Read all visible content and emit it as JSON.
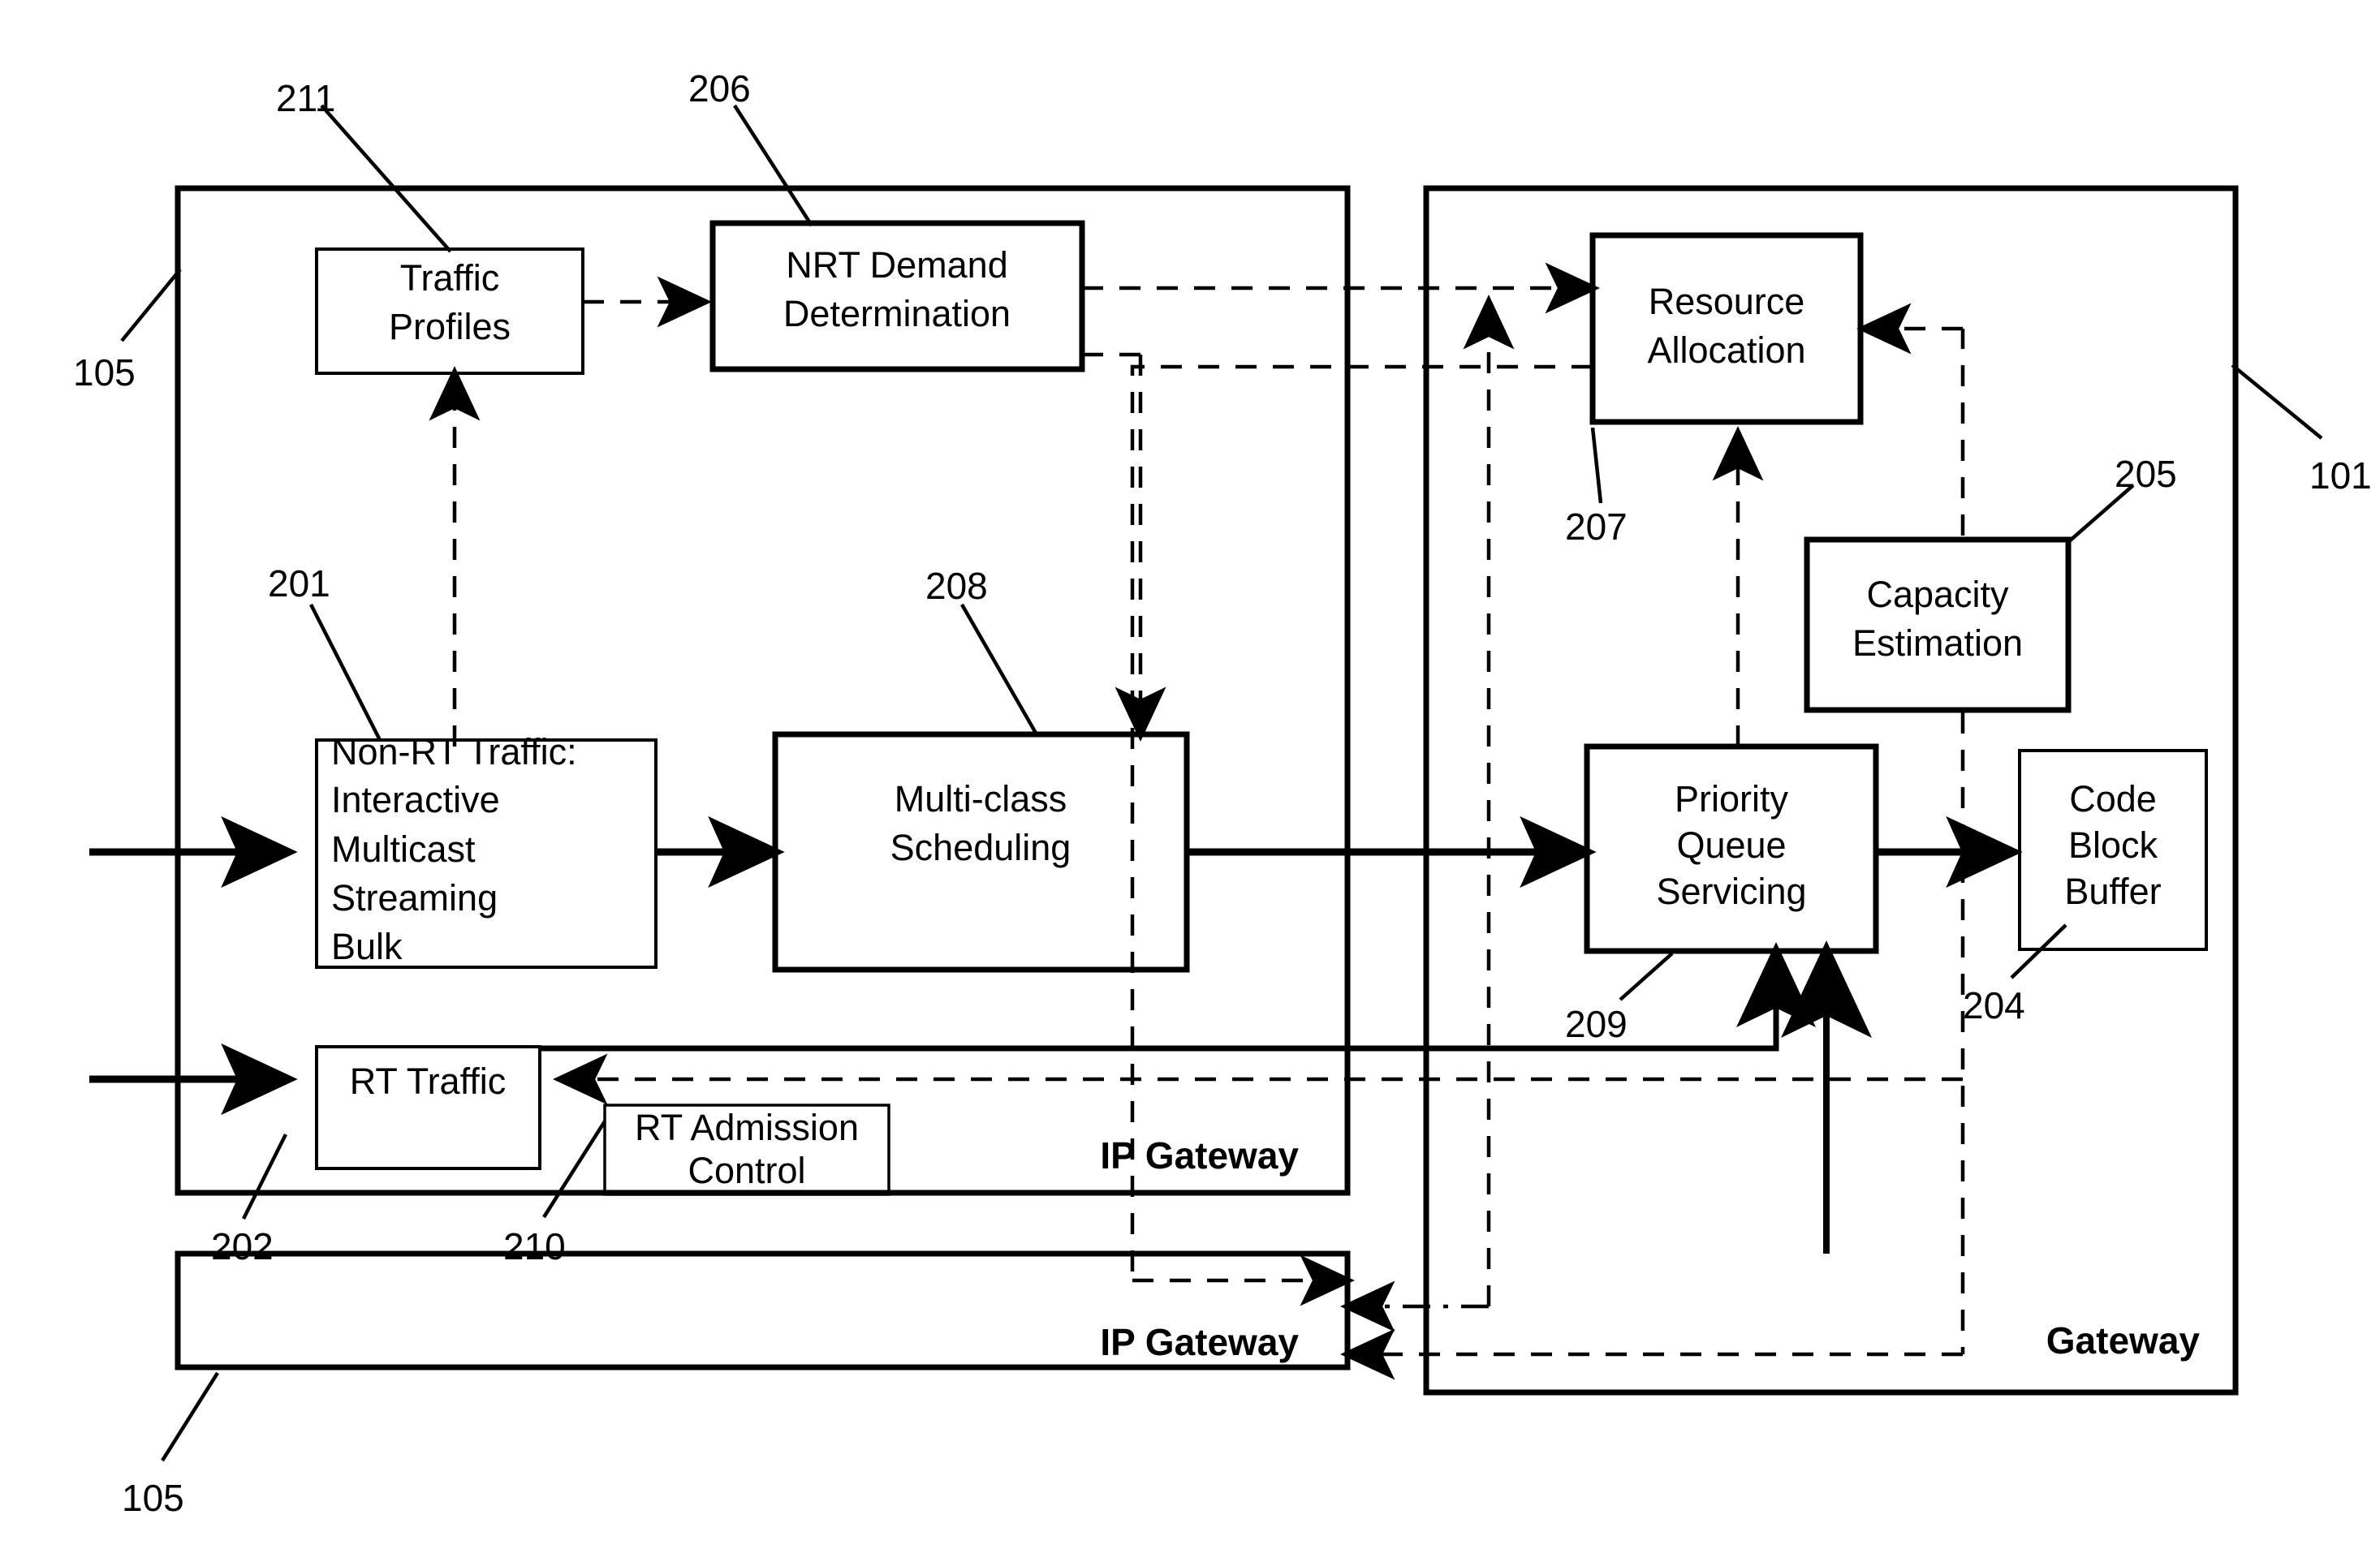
{
  "figure": {
    "title": "IP Gateway / Gateway resource allocation block diagram",
    "line_color": "#000000",
    "background": "#ffffff"
  },
  "panels": [
    {
      "id": "ip-gateway-top",
      "label": "IP Gateway",
      "ref": "105"
    },
    {
      "id": "ip-gateway-bottom",
      "label": "IP Gateway",
      "ref": "105"
    },
    {
      "id": "gateway-right",
      "label": "Gateway",
      "ref": "101"
    }
  ],
  "blocks": [
    {
      "id": "traffic-profiles",
      "lines": [
        "Traffic",
        "Profiles"
      ],
      "ref": "211"
    },
    {
      "id": "nrt-demand",
      "lines": [
        "NRT Demand",
        "Determination"
      ],
      "ref": "206"
    },
    {
      "id": "non-rt-traffic",
      "lines": [
        "Non-RT Traffic:",
        "Interactive",
        "Multicast",
        "Streaming",
        "Bulk"
      ],
      "ref": "201"
    },
    {
      "id": "multi-class-scheduling",
      "lines": [
        "Multi-class",
        "Scheduling"
      ],
      "ref": "208"
    },
    {
      "id": "rt-traffic",
      "lines": [
        "RT Traffic"
      ],
      "ref": "202"
    },
    {
      "id": "rt-admission-control",
      "lines": [
        "RT Admission",
        "Control"
      ],
      "ref": "210"
    },
    {
      "id": "resource-allocation",
      "lines": [
        "Resource",
        "Allocation"
      ],
      "ref": "207"
    },
    {
      "id": "capacity-estimation",
      "lines": [
        "Capacity",
        "Estimation"
      ],
      "ref": "205"
    },
    {
      "id": "priority-queue",
      "lines": [
        "Priority",
        "Queue",
        "Servicing"
      ],
      "ref": "209"
    },
    {
      "id": "code-block-buffer",
      "lines": [
        "Code",
        "Block",
        "Buffer"
      ],
      "ref": "204"
    }
  ],
  "reference_numbers": [
    {
      "id": "ref-211",
      "value": "211"
    },
    {
      "id": "ref-206",
      "value": "206"
    },
    {
      "id": "ref-105-top",
      "value": "105"
    },
    {
      "id": "ref-101",
      "value": "101"
    },
    {
      "id": "ref-201",
      "value": "201"
    },
    {
      "id": "ref-208",
      "value": "208"
    },
    {
      "id": "ref-207",
      "value": "207"
    },
    {
      "id": "ref-205",
      "value": "205"
    },
    {
      "id": "ref-209",
      "value": "209"
    },
    {
      "id": "ref-204",
      "value": "204"
    },
    {
      "id": "ref-202",
      "value": "202"
    },
    {
      "id": "ref-210",
      "value": "210"
    },
    {
      "id": "ref-105-bottom",
      "value": "105"
    }
  ],
  "text": {
    "traffic_profiles_l1": "Traffic",
    "traffic_profiles_l2": "Profiles",
    "nrt_demand_l1": "NRT Demand",
    "nrt_demand_l2": "Determination",
    "non_rt_l1": "Non-RT Traffic:",
    "non_rt_l2": "Interactive",
    "non_rt_l3": "Multicast",
    "non_rt_l4": "Streaming",
    "non_rt_l5": "Bulk",
    "multiclass_l1": "Multi-class",
    "multiclass_l2": "Scheduling",
    "rt_traffic_l1": "RT Traffic",
    "rt_admission_l1": "RT Admission",
    "rt_admission_l2": "Control",
    "resource_alloc_l1": "Resource",
    "resource_alloc_l2": "Allocation",
    "capacity_l1": "Capacity",
    "capacity_l2": "Estimation",
    "priority_l1": "Priority",
    "priority_l2": "Queue",
    "priority_l3": "Servicing",
    "code_block_l1": "Code",
    "code_block_l2": "Block",
    "code_block_l3": "Buffer",
    "ip_gateway_top": "IP Gateway",
    "ip_gateway_bottom": "IP Gateway",
    "gateway_right": "Gateway",
    "ref_211": "211",
    "ref_206": "206",
    "ref_105_top": "105",
    "ref_101": "101",
    "ref_201": "201",
    "ref_208": "208",
    "ref_207": "207",
    "ref_205": "205",
    "ref_209": "209",
    "ref_204": "204",
    "ref_202": "202",
    "ref_210": "210",
    "ref_105_bottom": "105"
  }
}
